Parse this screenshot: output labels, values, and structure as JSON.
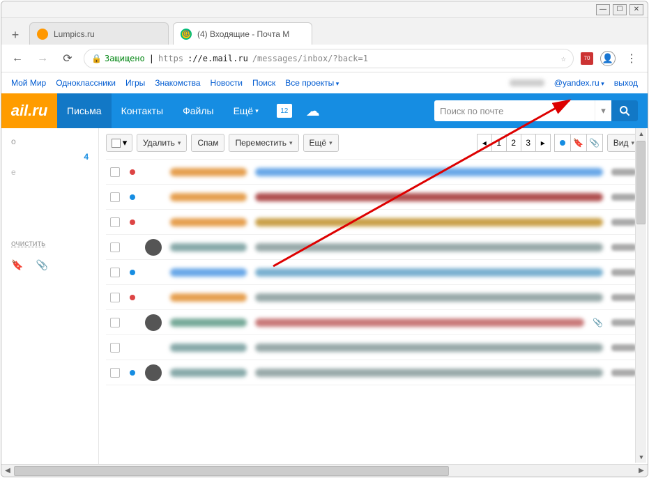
{
  "window": {
    "min": "—",
    "max": "☐",
    "close": "✕"
  },
  "tabs": [
    {
      "label": "Lumpics.ru",
      "fav": "l"
    },
    {
      "label": "(4) Входящие - Почта M",
      "fav": "m"
    }
  ],
  "urlbar": {
    "secure_label": "Защищено",
    "proto": "https",
    "host": "://e.mail.ru",
    "path": "/messages/inbox/?back=1",
    "shield_badge": "70"
  },
  "mailtop": {
    "links": [
      "Мой Мир",
      "Одноклассники",
      "Игры",
      "Знакомства",
      "Новости",
      "Поиск",
      "Все проекты"
    ],
    "user_suffix": "@yandex.ru",
    "exit": "выход"
  },
  "header": {
    "logo": "ail.ru",
    "nav": [
      "Письма",
      "Контакты",
      "Файлы",
      "Ещё"
    ],
    "calendar_day": "12",
    "search_placeholder": "Поиск по почте"
  },
  "toolbar": {
    "delete": "Удалить",
    "spam": "Спам",
    "move": "Переместить",
    "more": "Ещё",
    "view": "Вид",
    "pages": [
      "1",
      "2",
      "3"
    ]
  },
  "sidebar": {
    "inbox_count": "4",
    "clear": "очистить"
  },
  "rows": [
    {
      "unread": false,
      "red": true,
      "avatar": false,
      "sc": "#e6a050",
      "tc": "#6aa8e8",
      "clip": false
    },
    {
      "unread": true,
      "red": false,
      "avatar": false,
      "sc": "#e6a050",
      "tc": "#b05050",
      "clip": false
    },
    {
      "unread": false,
      "red": true,
      "avatar": false,
      "sc": "#e6a050",
      "tc": "#caa14a",
      "clip": false
    },
    {
      "unread": false,
      "red": false,
      "avatar": true,
      "sc": "#8aa",
      "tc": "#9aa",
      "clip": false
    },
    {
      "unread": true,
      "red": false,
      "avatar": false,
      "sc": "#6aa8e8",
      "tc": "#7ab0d0",
      "clip": false
    },
    {
      "unread": false,
      "red": true,
      "avatar": false,
      "sc": "#e6a050",
      "tc": "#9aa",
      "clip": false
    },
    {
      "unread": false,
      "red": false,
      "avatar": true,
      "sc": "#7a9",
      "tc": "#c97a7a",
      "clip": true
    },
    {
      "unread": false,
      "red": false,
      "avatar": false,
      "sc": "#8aa",
      "tc": "#9aa",
      "clip": false
    },
    {
      "unread": true,
      "red": false,
      "avatar": true,
      "sc": "#8aa",
      "tc": "#9aa",
      "clip": false
    }
  ]
}
